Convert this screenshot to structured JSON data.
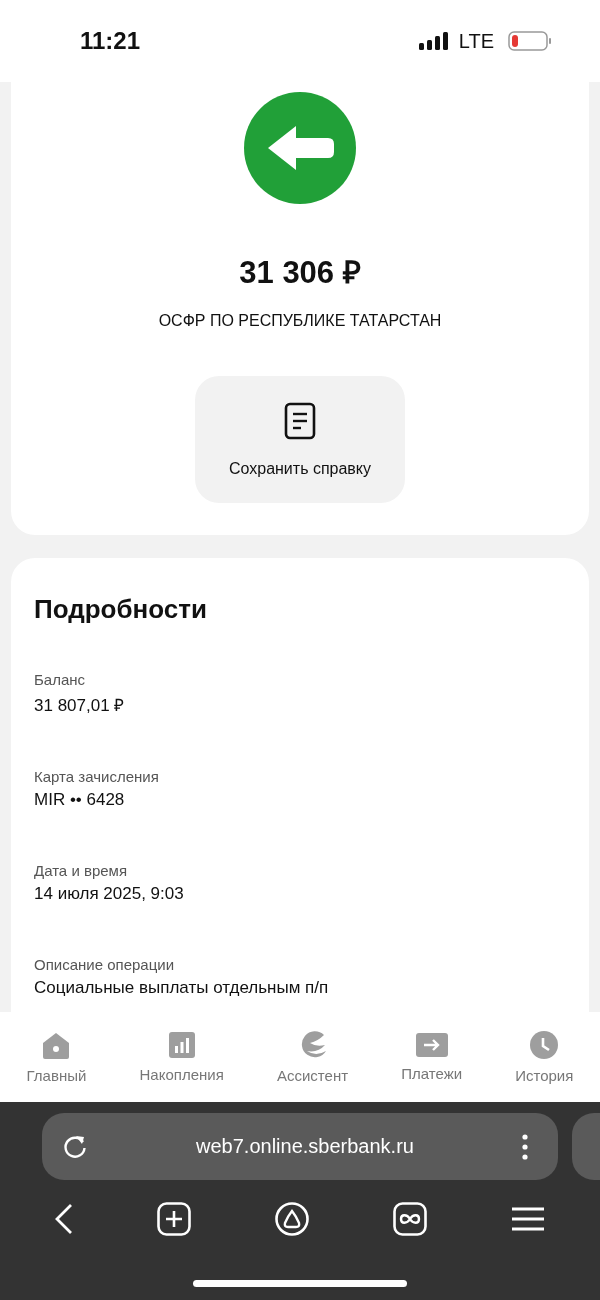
{
  "status_bar": {
    "time": "11:21",
    "network": "LTE"
  },
  "operation": {
    "amount": "31 306 ₽",
    "counterparty": "ОСФР ПО РЕСПУБЛИКЕ ТАТАРСТАН",
    "save_button": "Сохранить справку"
  },
  "details": {
    "title": "Подробности",
    "fields": [
      {
        "label": "Баланс",
        "value": "31 807,01 ₽"
      },
      {
        "label": "Карта зачисления",
        "value": "MIR •• 6428"
      },
      {
        "label": "Дата и время",
        "value": "14 июля 2025, 9:03"
      },
      {
        "label": "Описание операции",
        "value": "Социальные выплаты отдельным п/п"
      }
    ]
  },
  "bottom_nav": [
    {
      "kind": "home",
      "label": "Главный"
    },
    {
      "kind": "savings",
      "label": "Накопления"
    },
    {
      "kind": "assistant",
      "label": "Ассистент"
    },
    {
      "kind": "payments",
      "label": "Платежи"
    },
    {
      "kind": "history",
      "label": "История"
    }
  ],
  "browser": {
    "url": "web7.online.sberbank.ru"
  }
}
